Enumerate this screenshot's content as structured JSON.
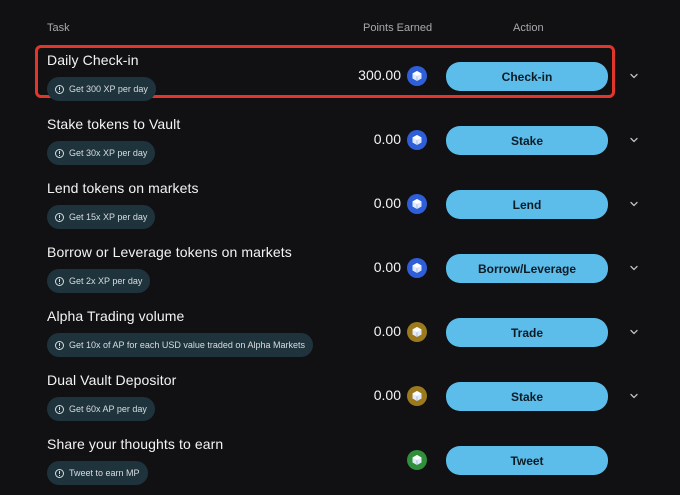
{
  "header": {
    "task": "Task",
    "points": "Points Earned",
    "action": "Action"
  },
  "rows": [
    {
      "title": "Daily Check-in",
      "hint": "Get 300 XP per day",
      "points": "300.00",
      "token": "blue",
      "action": "Check-in",
      "expand": true
    },
    {
      "title": "Stake tokens to Vault",
      "hint": "Get 30x XP per day",
      "points": "0.00",
      "token": "blue",
      "action": "Stake",
      "expand": true
    },
    {
      "title": "Lend tokens on markets",
      "hint": "Get 15x XP per day",
      "points": "0.00",
      "token": "blue",
      "action": "Lend",
      "expand": true
    },
    {
      "title": "Borrow or Leverage tokens on markets",
      "hint": "Get 2x XP per day",
      "points": "0.00",
      "token": "blue",
      "action": "Borrow/Leverage",
      "expand": true
    },
    {
      "title": "Alpha Trading volume",
      "hint": "Get 10x of AP for each USD value traded on Alpha Markets",
      "points": "0.00",
      "token": "gold",
      "action": "Trade",
      "expand": true
    },
    {
      "title": "Dual Vault Depositor",
      "hint": "Get 60x AP per day",
      "points": "0.00",
      "token": "gold",
      "action": "Stake",
      "expand": true
    },
    {
      "title": "Share your thoughts to earn",
      "hint": "Tweet to earn MP",
      "points": "",
      "token": "green",
      "action": "Tweet",
      "expand": false
    }
  ],
  "colors": {
    "background": "#111114",
    "action_button": "#5cbdeb",
    "highlight": "#e1372a",
    "token_blue": "#2f5fd8",
    "token_gold": "#9b7a1e",
    "token_green": "#2f8f3a"
  },
  "icons": {
    "info": "info-circle-icon",
    "token": "cube-token-icon",
    "expand": "chevron-down-icon"
  }
}
